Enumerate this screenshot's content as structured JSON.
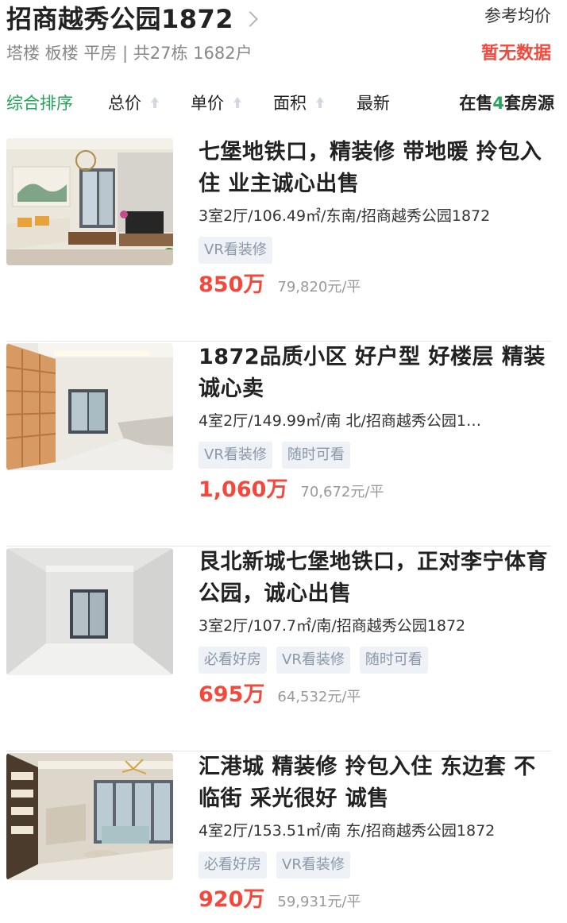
{
  "header": {
    "title": "招商越秀公园1872",
    "subtitle": "塔楼 板楼 平房 | 共27栋 1682户",
    "ref_label": "参考均价",
    "ref_value": "暂无数据"
  },
  "sort": {
    "items": [
      {
        "label": "综合排序"
      },
      {
        "label": "总价"
      },
      {
        "label": "单价"
      },
      {
        "label": "面积"
      },
      {
        "label": "最新"
      }
    ],
    "count_prefix": "在售",
    "count": "4",
    "count_suffix": "套房源"
  },
  "listings": [
    {
      "title": "七堡地铁口，精装修 带地暖 拎包入住 业主诚心出售",
      "desc": "3室2厅/106.49㎡/东南/招商越秀公园1872",
      "tags": [
        "VR看装修"
      ],
      "price": "850万",
      "unit_price": "79,820元/平"
    },
    {
      "title": "1872品质小区 好户型 好楼层 精装诚心卖",
      "desc": "4室2厅/149.99㎡/南 北/招商越秀公园1…",
      "tags": [
        "VR看装修",
        "随时可看"
      ],
      "price": "1,060万",
      "unit_price": "70,672元/平"
    },
    {
      "title": "艮北新城七堡地铁口，正对李宁体育公园，诚心出售",
      "desc": "3室2厅/107.7㎡/南/招商越秀公园1872",
      "tags": [
        "必看好房",
        "VR看装修",
        "随时可看"
      ],
      "price": "695万",
      "unit_price": "64,532元/平"
    },
    {
      "title": "汇港城 精装修 拎包入住 东边套 不临街 采光很好 诚售",
      "desc": "4室2厅/153.51㎡/南 东/招商越秀公园1872",
      "tags": [
        "必看好房",
        "VR看装修"
      ],
      "price": "920万",
      "unit_price": "59,931元/平"
    }
  ],
  "colors": {
    "accent_green": "#22a559",
    "price_red": "#f4483c",
    "tag_bg": "#eef1f5",
    "tag_text": "#8a97a8"
  }
}
